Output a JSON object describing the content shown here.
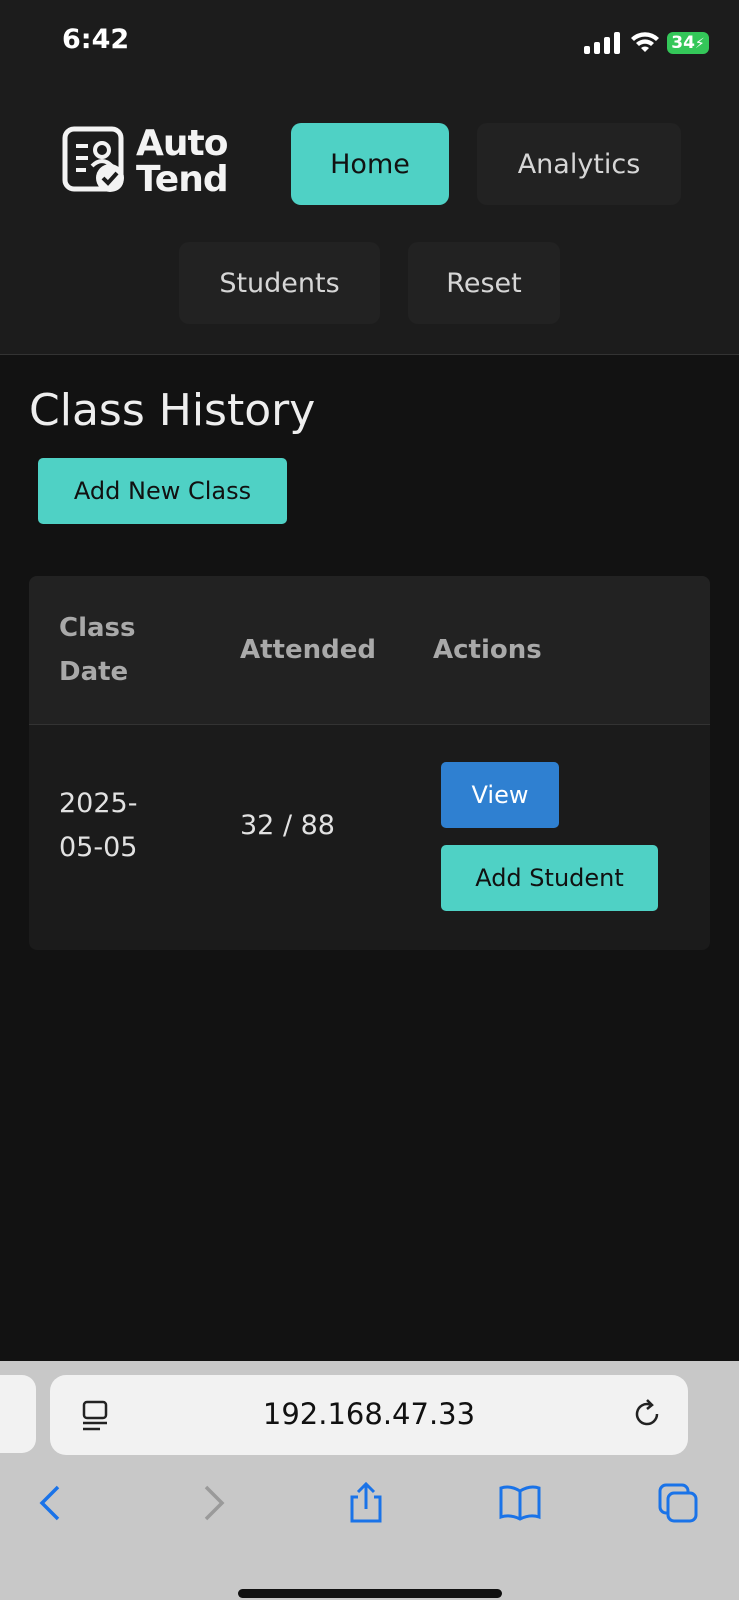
{
  "status_bar": {
    "time": "6:42",
    "battery": "34"
  },
  "header": {
    "logo": {
      "line1": "Auto",
      "line2": "Tend"
    },
    "nav": {
      "home": "Home",
      "analytics": "Analytics",
      "students": "Students",
      "reset": "Reset"
    },
    "active_nav": "Home"
  },
  "main": {
    "title": "Class History",
    "add_class_label": "Add New Class",
    "table": {
      "columns": [
        "Class Date",
        "Attended",
        "Actions"
      ],
      "column_lines": {
        "date": [
          "Class",
          "Date"
        ]
      },
      "rows": [
        {
          "date_lines": [
            "2025-",
            "05-05"
          ],
          "attended": "32 / 88",
          "actions": {
            "view": "View",
            "add_student": "Add Student"
          }
        }
      ]
    }
  },
  "browser": {
    "url": "192.168.47.33"
  },
  "colors": {
    "accent": "#4fd1c5",
    "view_button": "#2f80d1",
    "background": "#121212",
    "header": "#1c1c1c"
  },
  "icons": [
    "signal-icon",
    "wifi-icon",
    "battery-icon",
    "logo-icon",
    "reader-icon",
    "reload-icon",
    "back-icon",
    "forward-icon",
    "share-icon",
    "bookmarks-icon",
    "tabs-icon"
  ]
}
